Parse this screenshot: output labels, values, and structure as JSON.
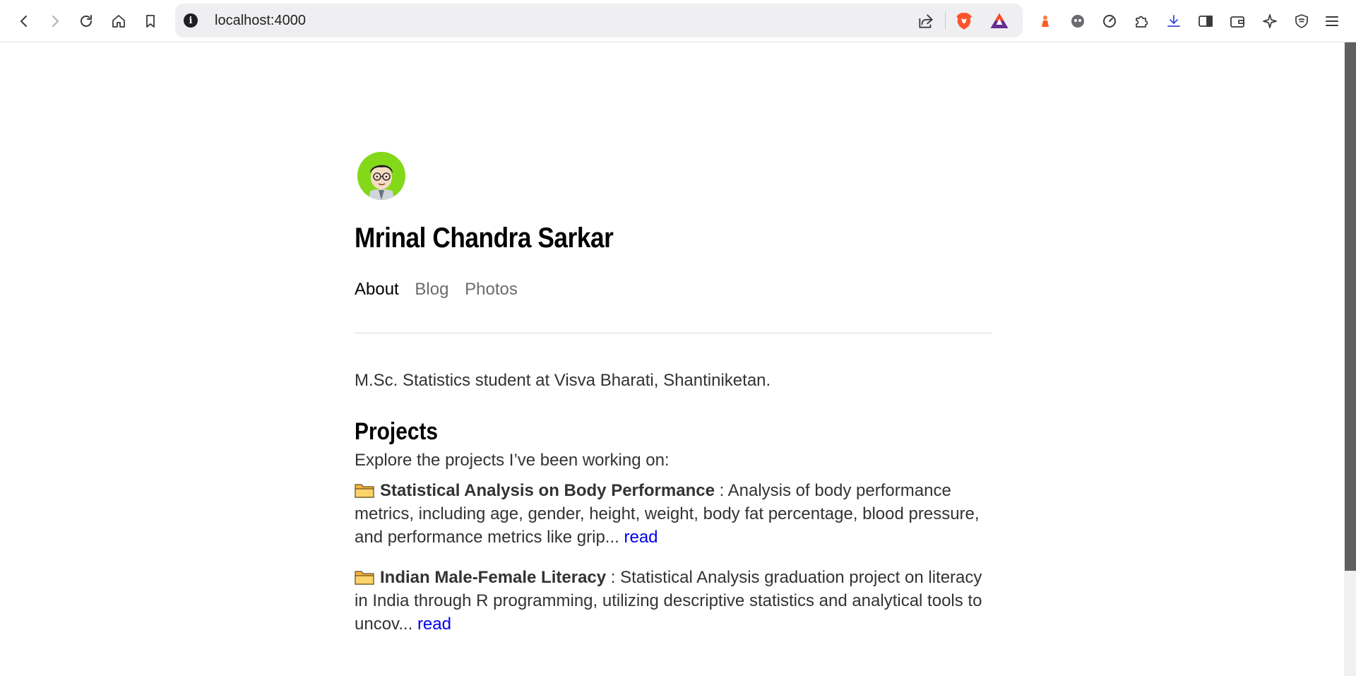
{
  "browser": {
    "url": "localhost:4000",
    "icons": [
      "back-icon",
      "forward-icon",
      "reload-icon",
      "home-icon",
      "bookmark-icon",
      "site-info-icon",
      "share-icon",
      "brave-shields-icon",
      "brave-rewards-icon",
      "leo-icon",
      "vpn-icon",
      "speed-icon",
      "extensions-icon",
      "downloads-icon",
      "sidebar-icon",
      "wallet-icon",
      "ai-icon",
      "shield-icon",
      "menu-icon"
    ]
  },
  "site": {
    "title": "Mrinal Chandra Sarkar",
    "nav": [
      {
        "label": "About",
        "active": true
      },
      {
        "label": "Blog",
        "active": false
      },
      {
        "label": "Photos",
        "active": false
      }
    ],
    "bio": "M.Sc. Statistics student at Visva Bharati, Shantiniketan."
  },
  "projects": {
    "heading": "Projects",
    "intro": "Explore the projects I’ve been working on:",
    "items": [
      {
        "name": "Statistical Analysis on Body Performance",
        "separator": " : ",
        "description": "Analysis of body performance metrics, including age, gender, height, weight, body fat percentage, blood pressure, and performance metrics like grip...",
        "link": "read"
      },
      {
        "name": "Indian Male-Female Literacy",
        "separator": " : ",
        "description": "Statistical Analysis graduation project on literacy in India through R programming, utilizing descriptive statistics and analytical tools to uncov...",
        "link": "read"
      }
    ]
  },
  "colors": {
    "link": "#0000ee",
    "avatar_bg": "#84d81a",
    "brave_orange": "#fb542b",
    "text": "#333333"
  }
}
